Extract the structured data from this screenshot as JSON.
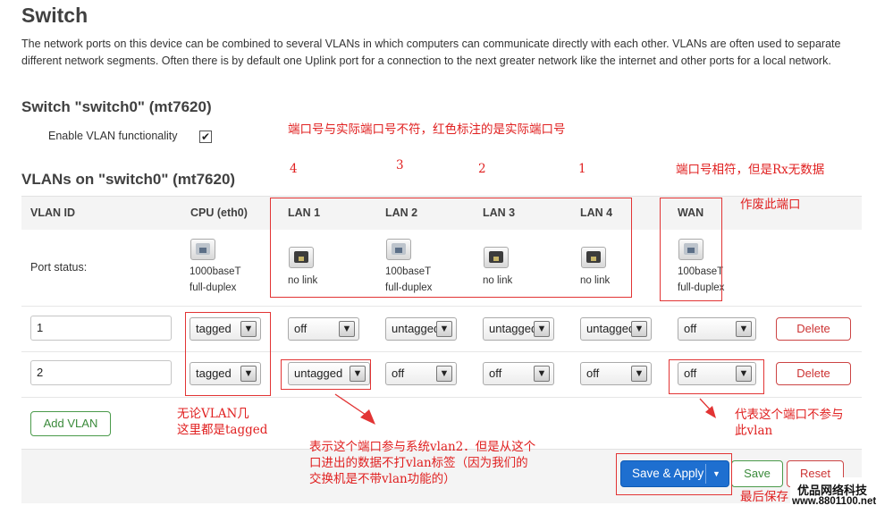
{
  "page": {
    "title": "Switch",
    "description": "The network ports on this device can be combined to several VLANs in which computers can communicate directly with each other. VLANs are often used to separate different network segments. Often there is by default one Uplink port for a connection to the next greater network like the internet and other ports for a local network."
  },
  "switch_section": {
    "heading": "Switch \"switch0\" (mt7620)",
    "enable_vlan_label": "Enable VLAN functionality",
    "enable_vlan_checked": true,
    "check_glyph": "✔"
  },
  "vlans_section": {
    "heading": "VLANs on \"switch0\" (mt7620)",
    "columns": [
      "VLAN ID",
      "CPU (eth0)",
      "LAN 1",
      "LAN 2",
      "LAN 3",
      "LAN 4",
      "WAN"
    ],
    "port_status_label": "Port status:",
    "port_status": [
      {
        "port": "CPU (eth0)",
        "icon": "port-link-up-icon",
        "line1": "1000baseT",
        "line2": "full-duplex"
      },
      {
        "port": "LAN 1",
        "icon": "port-no-link-icon",
        "line1": "no link",
        "line2": ""
      },
      {
        "port": "LAN 2",
        "icon": "port-link-up-icon",
        "line1": "100baseT",
        "line2": "full-duplex"
      },
      {
        "port": "LAN 3",
        "icon": "port-no-link-icon",
        "line1": "no link",
        "line2": ""
      },
      {
        "port": "LAN 4",
        "icon": "port-no-link-icon",
        "line1": "no link",
        "line2": ""
      },
      {
        "port": "WAN",
        "icon": "port-link-up-icon",
        "line1": "100baseT",
        "line2": "full-duplex"
      }
    ],
    "rows": [
      {
        "vlan_id": "1",
        "cpu": "tagged",
        "lan1": "off",
        "lan2": "untagged",
        "lan3": "untagged",
        "lan4": "untagged",
        "wan": "off",
        "delete_label": "Delete"
      },
      {
        "vlan_id": "2",
        "cpu": "tagged",
        "lan1": "untagged",
        "lan2": "off",
        "lan3": "off",
        "lan4": "off",
        "wan": "off",
        "delete_label": "Delete"
      }
    ],
    "add_vlan_label": "Add VLAN",
    "dropdown_glyph": "▼"
  },
  "footer": {
    "save_apply_label": "Save & Apply",
    "save_apply_dropdown_glyph": "▼",
    "save_label": "Save",
    "reset_label": "Reset"
  },
  "annotations": {
    "port_mismatch_note": "端口号与实际端口号不符，红色标注的是实际端口号",
    "real_port_numbers": [
      "4",
      "3",
      "2",
      "1"
    ],
    "wan_note": "端口号相符，但是Rx无数据",
    "wan_note2": "作废此端口",
    "cpu_note_line1": "无论VLAN几",
    "cpu_note_line2": "这里都是tagged",
    "lan1_note_line1": "表示这个端口参与系统vlan2．但是从这个",
    "lan1_note_line2": "口进出的数据不打vlan标签（因为我们的",
    "lan1_note_line3": "交换机是不带vlan功能的）",
    "wan_off_note_line1": "代表这个端口不参与",
    "wan_off_note_line2": "此vlan",
    "save_note": "最后保存",
    "color": "#e02020"
  },
  "watermark": {
    "line1": "优品网络科技",
    "line2": "www.8801100.net"
  }
}
